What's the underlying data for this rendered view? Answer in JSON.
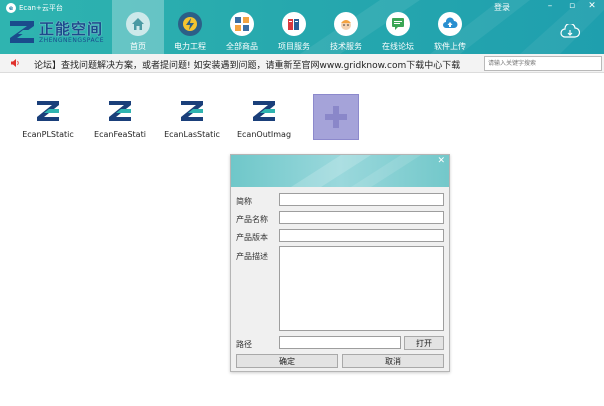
{
  "titlebar": {
    "title": "Ecan+云平台"
  },
  "brand": {
    "name_cn": "正能空间",
    "name_en": "ZHENGNENGSPACE"
  },
  "nav": [
    {
      "label": "首页",
      "icon": "home-icon"
    },
    {
      "label": "电力工程",
      "icon": "power-icon"
    },
    {
      "label": "全部商品",
      "icon": "grid-icon"
    },
    {
      "label": "项目服务",
      "icon": "books-icon"
    },
    {
      "label": "技术服务",
      "icon": "engineer-icon"
    },
    {
      "label": "在线论坛",
      "icon": "forum-icon"
    },
    {
      "label": "软件上传",
      "icon": "upload-icon"
    }
  ],
  "header": {
    "login": "登录"
  },
  "window_controls": {
    "minimize": "–",
    "restore": "▫",
    "close": "✕"
  },
  "ticker": {
    "text": "论坛】查找问题解决方案，或者提问题!         如安装遇到问题，请重新至官网www.gridknow.com下载中心下载",
    "search_placeholder": "请输入关键字搜索"
  },
  "apps": [
    {
      "label": "EcanPLStatic"
    },
    {
      "label": "EcanFeaStati"
    },
    {
      "label": "EcanLasStatic"
    },
    {
      "label": "EcanOutImag"
    }
  ],
  "dialog": {
    "close": "✕",
    "fields": {
      "short_name": {
        "label": "简称",
        "value": ""
      },
      "product_name": {
        "label": "产品名称",
        "value": ""
      },
      "product_version": {
        "label": "产品版本",
        "value": ""
      },
      "product_desc": {
        "label": "产品描述",
        "value": ""
      },
      "path": {
        "label": "路径",
        "value": ""
      }
    },
    "open_button": "打开",
    "ok_button": "确定",
    "cancel_button": "取消"
  },
  "colors": {
    "header": "#27a9ae",
    "add_tile": "#a5a3d9",
    "brand_blue": "#1a4b8c"
  }
}
